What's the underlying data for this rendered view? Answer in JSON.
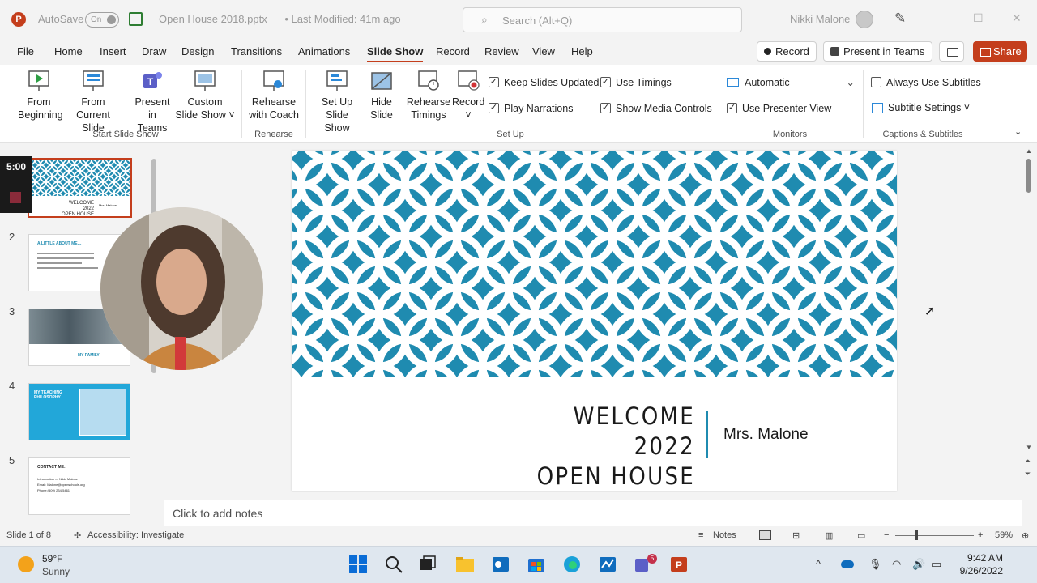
{
  "titlebar": {
    "autosave_label": "AutoSave",
    "autosave_state": "On",
    "document": "Open House 2018.pptx",
    "modified": "• Last Modified: 41m ago",
    "search_placeholder": "Search (Alt+Q)",
    "user": "Nikki Malone",
    "minimize": "—",
    "maximize": "☐",
    "close": "✕"
  },
  "menu": {
    "items": [
      "File",
      "Home",
      "Insert",
      "Draw",
      "Design",
      "Transitions",
      "Animations",
      "Slide Show",
      "Record",
      "Review",
      "View",
      "Help"
    ],
    "active": "Slide Show",
    "record_label": "Record",
    "teams_label": "Present in Teams",
    "share_label": "Share"
  },
  "ribbon": {
    "start": {
      "from_beginning": "From Beginning",
      "from_current": "From Current Slide",
      "present_teams": "Present in Teams",
      "custom_show": "Custom Slide Show ˅",
      "label": "Start Slide Show"
    },
    "rehearse": {
      "coach": "Rehearse with Coach",
      "label": "Rehearse"
    },
    "setup": {
      "set_up": "Set Up Slide Show",
      "hide": "Hide Slide",
      "timings": "Rehearse Timings",
      "record": "Record",
      "record_caret": "˅",
      "keep_updated": "Keep Slides Updated",
      "play_narrations": "Play Narrations",
      "use_timings": "Use Timings",
      "media_controls": "Show Media Controls",
      "label": "Set Up"
    },
    "monitors": {
      "monitor": "Automatic",
      "presenter_view": "Use Presenter View",
      "label": "Monitors"
    },
    "captions": {
      "always_subtitles": "Always Use Subtitles",
      "subtitle_settings": "Subtitle Settings ˅",
      "label": "Captions & Subtitles"
    },
    "check_mark": "✓"
  },
  "thumbnails": {
    "timer": "5:00",
    "numbers": [
      "2",
      "3",
      "4",
      "5"
    ],
    "slide1_line1": "WELCOME 2022",
    "slide1_line2": "OPEN HOUSE",
    "slide1_side": "Mrs. Malone",
    "slide2_title": "A LITTLE ABOUT ME…",
    "slide3_caption": "MY FAMILY",
    "slide4_title": "MY TEACHING PHILOSOPHY",
    "slide5_title": "CONTACT ME:",
    "slide5_line1": "Introduction — Nikki Malone",
    "slide5_line2": "Email: Malone@openschools.org",
    "slide5_line3": "Phone:(509) 234-5461"
  },
  "slide": {
    "title_line1": "WELCOME 2022",
    "title_line2": "OPEN HOUSE",
    "subtitle": "Mrs. Malone",
    "pattern_color": "#1f8bb0"
  },
  "notes_placeholder": "Click to add notes",
  "statusbar": {
    "slide_of": "Slide 1 of 8",
    "accessibility": "Accessibility: Investigate",
    "notes": "Notes",
    "zoom": "59%",
    "minus": "−",
    "plus": "+"
  },
  "taskbar": {
    "temperature": "59°F",
    "condition": "Sunny",
    "time": "9:42 AM",
    "date": "9/26/2022",
    "teams_badge": "5"
  }
}
